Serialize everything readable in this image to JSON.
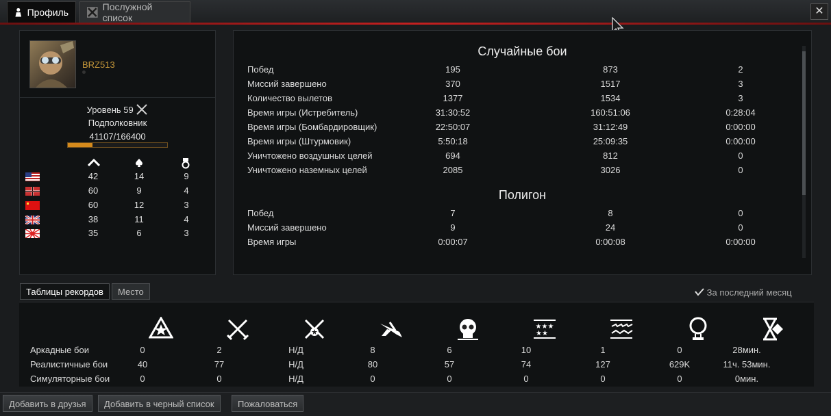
{
  "tabs": [
    {
      "label": "Профиль"
    },
    {
      "label": "Послужной список"
    }
  ],
  "close_label": "✕",
  "profile": {
    "nickname": "BRZ513",
    "level_text": "Уровень 59",
    "rank": "Подполковник",
    "xp_text": "41107/166400",
    "xp_fraction": 0.247
  },
  "nations_header_icons": [
    "rank-chevron-icon",
    "spade-icon",
    "medal-icon"
  ],
  "nations": [
    {
      "flag": "usa-flag-icon",
      "c1": "42",
      "c2": "14",
      "c3": "9"
    },
    {
      "flag": "germany-flag-icon",
      "c1": "60",
      "c2": "9",
      "c3": "4"
    },
    {
      "flag": "ussr-flag-icon",
      "c1": "60",
      "c2": "12",
      "c3": "3"
    },
    {
      "flag": "uk-flag-icon",
      "c1": "38",
      "c2": "11",
      "c3": "4"
    },
    {
      "flag": "japan-flag-icon",
      "c1": "35",
      "c2": "6",
      "c3": "3"
    }
  ],
  "random_battles": {
    "title": "Случайные бои",
    "rows": [
      {
        "label": "Побед",
        "v1": "195",
        "v2": "873",
        "v3": "2"
      },
      {
        "label": "Миссий завершено",
        "v1": "370",
        "v2": "1517",
        "v3": "3"
      },
      {
        "label": "Количество вылетов",
        "v1": "1377",
        "v2": "1534",
        "v3": "3"
      },
      {
        "label": "Время игры (Истребитель)",
        "v1": "31:30:52",
        "v2": "160:51:06",
        "v3": "0:28:04"
      },
      {
        "label": "Время игры (Бомбардировщик)",
        "v1": "22:50:07",
        "v2": "31:12:49",
        "v3": "0:00:00"
      },
      {
        "label": "Время игры (Штурмовик)",
        "v1": "5:50:18",
        "v2": "25:09:35",
        "v3": "0:00:00"
      },
      {
        "label": "Уничтожено воздушных целей",
        "v1": "694",
        "v2": "812",
        "v3": "0"
      },
      {
        "label": "Уничтожено наземных целей",
        "v1": "2085",
        "v2": "3026",
        "v3": "0"
      }
    ]
  },
  "polygon": {
    "title": "Полигон",
    "rows": [
      {
        "label": "Побед",
        "v1": "7",
        "v2": "8",
        "v3": "0"
      },
      {
        "label": "Миссий завершено",
        "v1": "9",
        "v2": "24",
        "v3": "0"
      },
      {
        "label": "Время игры",
        "v1": "0:00:07",
        "v2": "0:00:08",
        "v3": "0:00:00"
      }
    ]
  },
  "records_tabs": [
    {
      "label": "Таблицы рекордов"
    },
    {
      "label": "Место"
    }
  ],
  "month_filter": "За последний месяц",
  "record_icons": [
    "star-badge-icon",
    "crossed-swords-icon",
    "crossed-swords-star-icon",
    "plane-dive-icon",
    "skull-icon",
    "stars-flag-icon",
    "birds-flag-icon",
    "balloon-icon",
    "hourglass-icon"
  ],
  "records": [
    {
      "label": "Аркадные бои",
      "values": [
        "0",
        "2",
        "Н/Д",
        "8",
        "6",
        "10",
        "1",
        "0",
        "28мин."
      ]
    },
    {
      "label": "Реалистичные бои",
      "values": [
        "40",
        "77",
        "Н/Д",
        "80",
        "57",
        "74",
        "127",
        "629K",
        "11ч. 53мин."
      ]
    },
    {
      "label": "Симуляторные бои",
      "values": [
        "0",
        "0",
        "Н/Д",
        "0",
        "0",
        "0",
        "0",
        "0",
        "0мин."
      ]
    }
  ],
  "footer_buttons": [
    {
      "label": "Добавить в друзья"
    },
    {
      "label": "Добавить в черный список"
    },
    {
      "label": "Пожаловаться"
    }
  ],
  "colors": {
    "accent_red": "#c42020",
    "nickname": "#c99a3b",
    "xp_fill": "#d58a1c"
  }
}
